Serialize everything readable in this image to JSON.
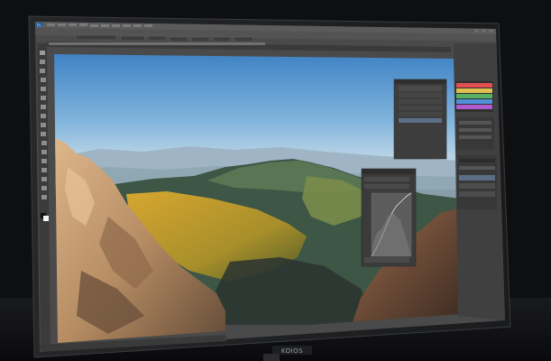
{
  "monitor": {
    "brand": "KOIOS"
  },
  "photoshop": {
    "logo": "Ps",
    "menus": [],
    "layer_panel_title": "",
    "layers": [],
    "curves_panel_title": "",
    "status_zoom": "",
    "status_doc": ""
  },
  "colors": {
    "bezel": "#1b1c1f",
    "ps_ui": "#535353",
    "ps_panel": "#3c3c3c",
    "sky_top": "#3f86c6",
    "sky_bottom": "#c7dbe8",
    "grass_sunlit": "#c99b2c",
    "rock": "#c9a27a"
  },
  "icons": [
    "move-tool-icon",
    "marquee-tool-icon",
    "lasso-tool-icon",
    "crop-tool-icon",
    "brush-tool-icon",
    "eraser-tool-icon",
    "zoom-tool-icon"
  ]
}
